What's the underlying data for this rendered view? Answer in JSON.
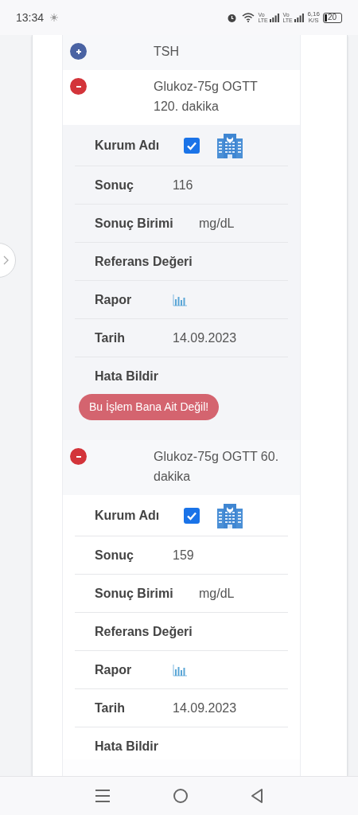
{
  "status_bar": {
    "time": "13:34",
    "volte_1": "Vo LTE",
    "volte_2": "Vo LTE",
    "speed": "6,16",
    "speed_unit": "K/S",
    "battery": "20"
  },
  "tests": [
    {
      "name": "TSH",
      "expanded": false
    },
    {
      "name": "Glukoz-75g OGTT 120. dakika",
      "expanded": true,
      "details": [
        {
          "kind": "institution",
          "label": "Kurum Adı",
          "checked": true
        },
        {
          "kind": "text",
          "label": "Sonuç",
          "value": "116"
        },
        {
          "kind": "text",
          "label": "Sonuç Birimi",
          "value": "mg/dL"
        },
        {
          "kind": "text",
          "label": "Referans Değeri"
        },
        {
          "kind": "report",
          "label": "Rapor"
        },
        {
          "kind": "text",
          "label": "Tarih",
          "value": "14.09.2023"
        },
        {
          "kind": "error",
          "label": "Hata Bildir",
          "button": "Bu İşlem Bana Ait Değil!"
        }
      ]
    },
    {
      "name": "Glukoz-75g OGTT 60. dakika",
      "expanded": true,
      "details": [
        {
          "kind": "institution",
          "label": "Kurum Adı",
          "checked": true
        },
        {
          "kind": "text",
          "label": "Sonuç",
          "value": "159"
        },
        {
          "kind": "text",
          "label": "Sonuç Birimi",
          "value": "mg/dL"
        },
        {
          "kind": "text",
          "label": "Referans Değeri"
        },
        {
          "kind": "report",
          "label": "Rapor"
        },
        {
          "kind": "text",
          "label": "Tarih",
          "value": "14.09.2023"
        },
        {
          "kind": "error",
          "label": "Hata Bildir"
        }
      ]
    }
  ]
}
